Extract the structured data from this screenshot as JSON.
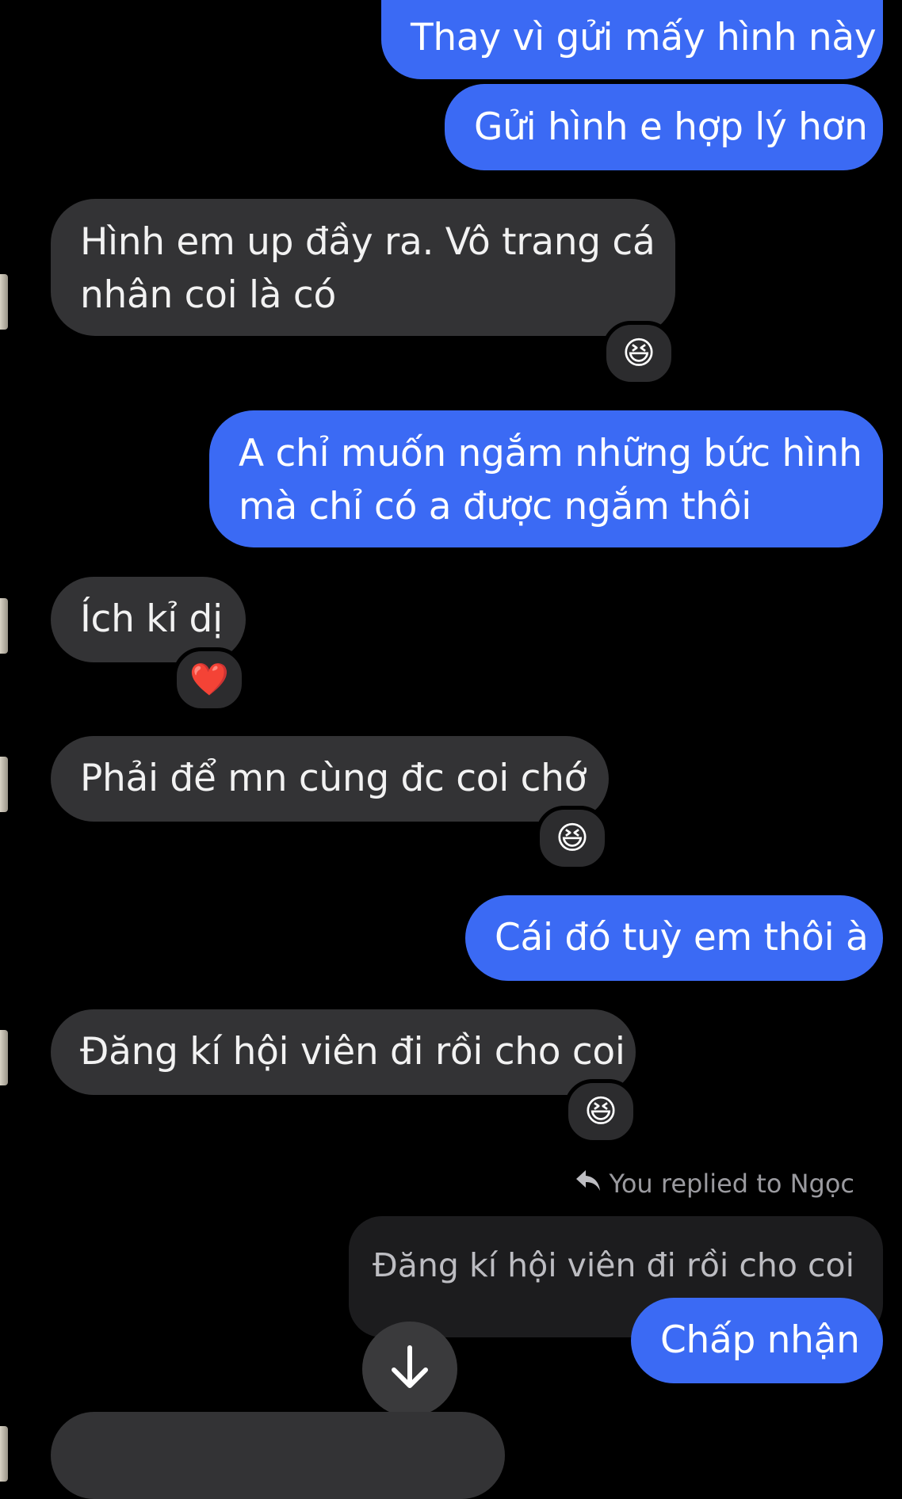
{
  "messages": [
    {
      "text": "Thay vì gửi mấy hình này"
    },
    {
      "text": "Gửi hình e hợp lý hơn"
    },
    {
      "line1": "Hình em up đầy ra. Vô trang cá",
      "line2": "nhân coi là có",
      "reaction": "😆"
    },
    {
      "line1": "A chỉ muốn ngắm những bức hình",
      "line2": "mà chỉ có a được ngắm thôi"
    },
    {
      "text": "Ích kỉ dị",
      "reaction": "❤️"
    },
    {
      "text": "Phải để mn cùng đc coi chớ",
      "reaction": "😆"
    },
    {
      "text": "Cái đó tuỳ em thôi à"
    },
    {
      "text": "Đăng kí hội viên đi rồi cho coi",
      "reaction": "😆"
    }
  ],
  "reply": {
    "meta_label": "You replied to Ngọc",
    "icon": "reply-arrow-icon",
    "quoted_text": "Đăng kí hội viên đi rồi cho coi",
    "reply_text": "Chấp nhận"
  },
  "scroll_button": {
    "icon": "arrow-down-icon"
  },
  "colors": {
    "outgoing": "#3b6af4",
    "incoming": "#333335",
    "background": "#000000"
  }
}
